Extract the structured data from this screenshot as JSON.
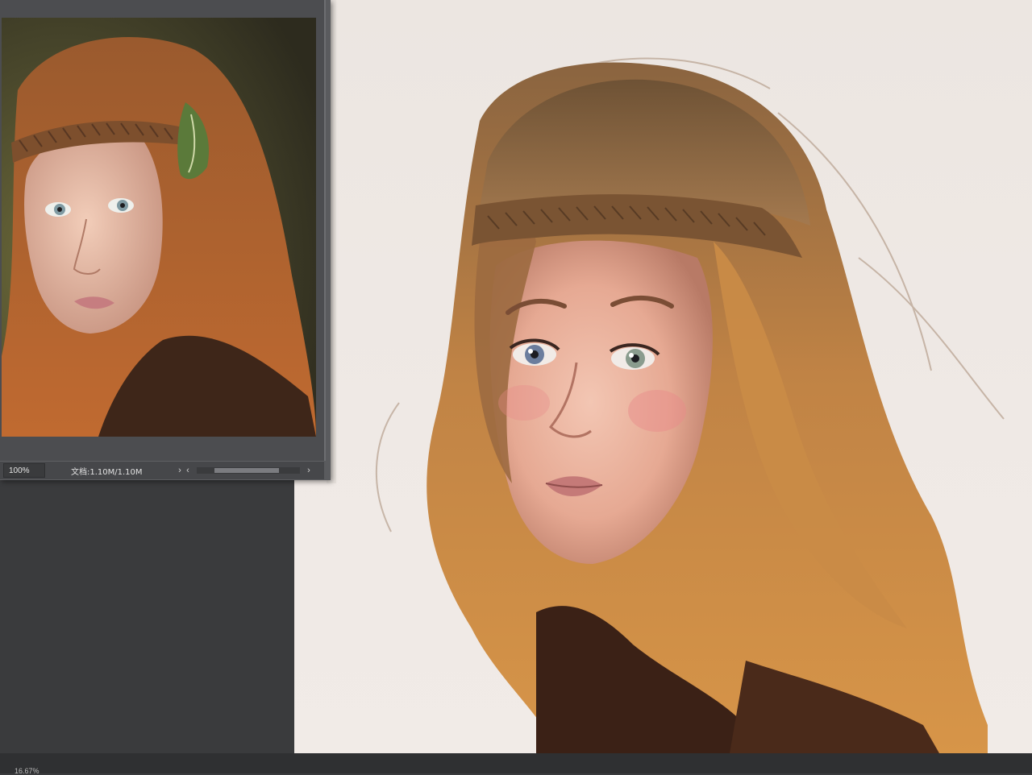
{
  "reference_window": {
    "zoom": "100%",
    "doc_info": "文档:1.10M/1.10M",
    "nav_left": "‹",
    "nav_right": "›",
    "scroll_right": "›",
    "scroll_left": "‹"
  },
  "bottom_bar": {
    "zoom_readout": "16.67%"
  },
  "colors": {
    "panel": "#5a5b5e",
    "desktop": "#3a3b3d",
    "canvas": "#ede7e2",
    "hair": "#b0713f"
  }
}
